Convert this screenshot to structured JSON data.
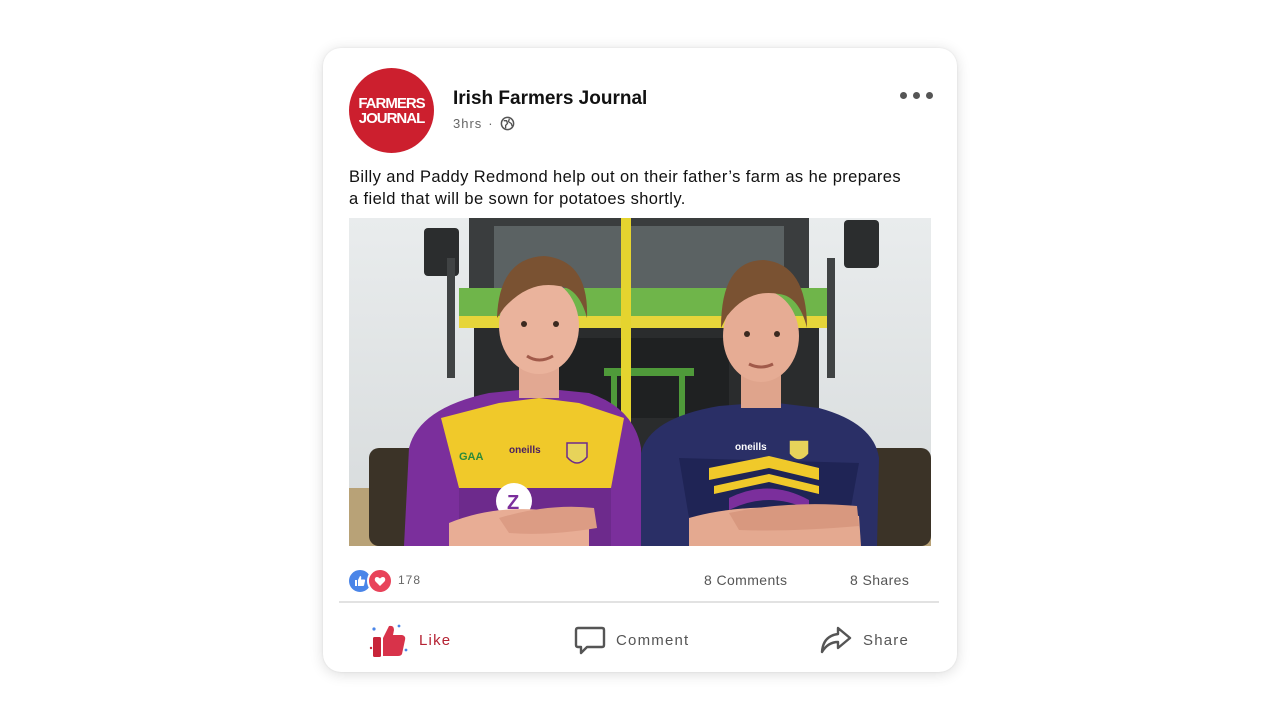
{
  "post": {
    "page_name": "Irish Farmers Journal",
    "logo_text_top": "FARMERS",
    "logo_text_bottom": "JOURNAL",
    "time": "3hrs",
    "privacy_icon": "globe-icon",
    "caption": "Billy and Paddy Redmond help out on their father’s farm as he prepares a field that will be sown for potatoes shortly.",
    "jersey_left": {
      "brand": "oneills",
      "gaa": "GAA"
    },
    "jersey_right": {
      "brand": "oneills"
    }
  },
  "stats": {
    "reactions_count": "178",
    "comments": "8 Comments",
    "shares": "8 Shares"
  },
  "actions": {
    "like": "Like",
    "comment": "Comment",
    "share": "Share"
  },
  "colors": {
    "brand_red": "#cc1f2e",
    "like_blue": "#4a85e8",
    "love_red": "#e8435a",
    "like_active": "#b52233"
  }
}
